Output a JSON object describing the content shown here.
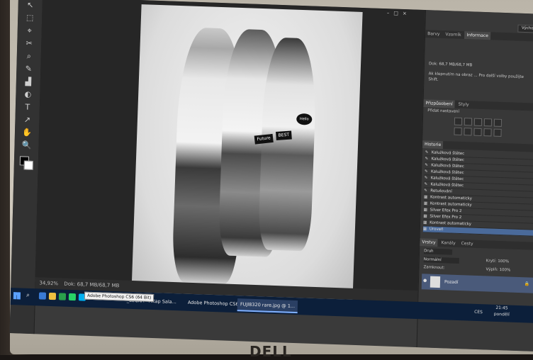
{
  "window": {
    "controls": [
      "–",
      "□",
      "×"
    ],
    "workspace_label": "Výchozí"
  },
  "tools": [
    "↖",
    "⬚",
    "⌖",
    "✂",
    "⌕",
    "✎",
    "▟",
    "◐",
    "T",
    "↗",
    "✋",
    "🔍"
  ],
  "status": {
    "zoom": "34,92%",
    "doc_size": "Dok: 68,7 MB/68,7 MB"
  },
  "photo": {
    "sign_left": "Future",
    "sign_right": "BEST",
    "bubble": "Hello"
  },
  "info_panel": {
    "tabs": [
      "Barvy",
      "Vzorník",
      "Informace"
    ],
    "doc_line": "Dok: 68,7 MB/68,7 MB",
    "hint": "Ak klepnutím na obraz ... Pro další volby použijte Shift."
  },
  "adjust_panel": {
    "tabs": [
      "Přizpůsobení",
      "Styly"
    ],
    "title": "Přidat nastavení"
  },
  "history": {
    "tab": "Historie",
    "items": [
      "Kalužková štětec",
      "Kalužková štětec",
      "Kalužková štětec",
      "Kalužková štětec",
      "Kalužková štětec",
      "Kalužková štětec",
      "Retušování",
      "Kontrast automaticky",
      "Kontrast automaticky",
      "Silver Efex Pro 2",
      "Silver Efex Pro 2",
      "Kontrast automaticky",
      "Úroveň"
    ]
  },
  "layers": {
    "tabs": [
      "Vrstvy",
      "Kanály",
      "Cesty"
    ],
    "filter": "Druh",
    "blend": "Normální",
    "opacity_label": "Krytí:",
    "opacity": "100%",
    "lock_label": "Zamknout:",
    "fill_label": "Výplň:",
    "fill": "100%",
    "bg_layer": "Pozadí"
  },
  "taskbar": {
    "tooltip": "Adobe Photoshop CS6 (64 Bit)",
    "items": [
      "_LUCKA - Altap Sala...",
      "Adobe Photoshop CS6",
      "FUJI8320 rare.jpg @ 1..."
    ],
    "lang": "CES",
    "time": "21:45",
    "day": "pondělí"
  },
  "brand": "DELL"
}
